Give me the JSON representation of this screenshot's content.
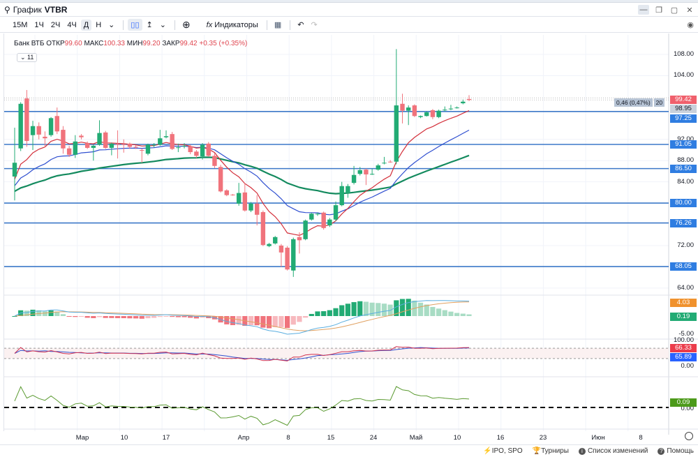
{
  "window": {
    "title_prefix": "График",
    "ticker": "VTBR"
  },
  "toolbar": {
    "timeframes": [
      "15М",
      "1Ч",
      "2Ч",
      "4Ч",
      "Д",
      "Н"
    ],
    "active_timeframe": "Д",
    "indicators_label": "Индикаторы"
  },
  "legend": {
    "name": "Банк ВТБ",
    "open_label": "ОТКР",
    "open": "99.60",
    "high_label": "МАКС",
    "high": "100.33",
    "low_label": "МИН",
    "low": "99.20",
    "close_label": "ЗАКР",
    "close": "99.42",
    "change": "+0.35 (+0.35%)",
    "collapsed_count": "11"
  },
  "price_axis": {
    "ticks": [
      "108.00",
      "104.00",
      "92.00",
      "88.00",
      "84.00",
      "72.00",
      "64.00"
    ],
    "tick_values": [
      108,
      104,
      92,
      88,
      84,
      72,
      64
    ]
  },
  "levels": [
    {
      "value": 97.25,
      "label": "97.25"
    },
    {
      "value": 91.05,
      "label": "91.05"
    },
    {
      "value": 86.5,
      "label": "86.50"
    },
    {
      "value": 80.0,
      "label": "80.00"
    },
    {
      "value": 76.26,
      "label": "76.26"
    },
    {
      "value": 68.05,
      "label": "68.05"
    }
  ],
  "price_labels": {
    "last": "99.42",
    "ma": "98.95",
    "diff": "0,46 (0,47%)",
    "diff_bars": "20"
  },
  "macd": {
    "ticks": [
      "-5.00"
    ],
    "signal_label": "4.03",
    "hist_label": "0.19"
  },
  "rsi": {
    "ticks": [
      "100.00",
      "0.00"
    ],
    "rsi_label": "66.33",
    "ma_label": "65.89"
  },
  "osc": {
    "ticks": [
      "0.00"
    ],
    "label": "0.09"
  },
  "time_axis": [
    "Мар",
    "10",
    "17",
    "Апр",
    "8",
    "15",
    "24",
    "Май",
    "10",
    "16",
    "23",
    "Июн",
    "8"
  ],
  "bottom": {
    "ipo": "IPO, SPO",
    "tournaments": "Турниры",
    "changes": "Список изменений",
    "help": "Помощь"
  },
  "colors": {
    "up": "#22ab74",
    "down": "#f0737c",
    "level": "#3c78c8",
    "ema_fast": "#d32f3a",
    "ema_mid": "#2f4fd0",
    "ema_slow": "#138a5e"
  },
  "chart_data": {
    "type": "candlestick",
    "ylim": [
      62,
      111
    ],
    "ema_seeds": [
      83.7,
      82.8,
      82.0
    ],
    "candles": [
      [
        85,
        94.2,
        80.5,
        87.6
      ],
      [
        90.3,
        99,
        89.8,
        98.7
      ],
      [
        99.7,
        101.3,
        90.6,
        91.7
      ],
      [
        92.8,
        95.5,
        90,
        94.5
      ],
      [
        94.5,
        95.2,
        92,
        92.9
      ],
      [
        92.5,
        93.5,
        90.5,
        92.2
      ],
      [
        92.8,
        96.2,
        92.5,
        96
      ],
      [
        96.4,
        98,
        93,
        93.5
      ],
      [
        93.8,
        94.5,
        89.3,
        90.3
      ],
      [
        90.3,
        90.8,
        88.7,
        89.1
      ],
      [
        89.1,
        92.8,
        88.5,
        91.6
      ],
      [
        92.7,
        93,
        92,
        92.4
      ],
      [
        91.3,
        91.6,
        90.2,
        90.4
      ],
      [
        90.4,
        91,
        88,
        90.8
      ],
      [
        91,
        95.6,
        90.8,
        93.2
      ],
      [
        93.3,
        93.6,
        90.2,
        90.4
      ],
      [
        90.4,
        91.4,
        89,
        91.2
      ],
      [
        91.1,
        93.7,
        88.4,
        91
      ],
      [
        91.1,
        92,
        89.5,
        91
      ],
      [
        91.2,
        91.4,
        90.2,
        90.6
      ],
      [
        90.6,
        90.9,
        90.2,
        90.5
      ],
      [
        90,
        90.3,
        87.6,
        89.9
      ],
      [
        89.3,
        91.2,
        89,
        91
      ],
      [
        91,
        91.3,
        90.5,
        91
      ],
      [
        91,
        93.8,
        90.8,
        92.2
      ],
      [
        92.4,
        93.7,
        92.2,
        92.6
      ],
      [
        93,
        93.4,
        90,
        90.2
      ],
      [
        90.4,
        91.2,
        89.6,
        90.5
      ],
      [
        90.7,
        91.3,
        90.3,
        90.8
      ],
      [
        90.7,
        91,
        89.2,
        89.6
      ],
      [
        89.7,
        90,
        88.5,
        88.9
      ],
      [
        88.8,
        91.3,
        88.2,
        91
      ],
      [
        91.2,
        91.5,
        88.7,
        88.9
      ],
      [
        88.9,
        89.4,
        86.6,
        87
      ],
      [
        86.8,
        87.2,
        82,
        82.2
      ],
      [
        82.4,
        82.6,
        81.3,
        81.5
      ],
      [
        81.6,
        81.7,
        81.4,
        81.5
      ],
      [
        79.9,
        83.8,
        79.5,
        81.9
      ],
      [
        82,
        83.8,
        78.4,
        78.6
      ],
      [
        78.6,
        80.2,
        78.3,
        79.9
      ],
      [
        79.9,
        81.5,
        75.8,
        77.8
      ],
      [
        78.3,
        78.6,
        71.9,
        72.1
      ],
      [
        71.9,
        72.5,
        71.7,
        72.3
      ],
      [
        72.4,
        73.8,
        72.2,
        73.6
      ],
      [
        72,
        72.3,
        68,
        70.7
      ],
      [
        71.6,
        71.9,
        67.3,
        67.5
      ],
      [
        67.3,
        73.5,
        66.1,
        73.2
      ],
      [
        73.6,
        74.5,
        70.5,
        73
      ],
      [
        73.2,
        76.9,
        73,
        76.7
      ],
      [
        76.9,
        78.2,
        76.7,
        78
      ],
      [
        78,
        78.2,
        77.6,
        78
      ],
      [
        78.2,
        78.4,
        75,
        75.3
      ],
      [
        75.8,
        77.2,
        75.5,
        76.9
      ],
      [
        76.9,
        80.3,
        76.6,
        79.6
      ],
      [
        79.6,
        84,
        79.4,
        83.2
      ],
      [
        81.9,
        83.6,
        81,
        83.2
      ],
      [
        83.8,
        87,
        83.5,
        85.3
      ],
      [
        85.5,
        86.8,
        85.2,
        86.2
      ],
      [
        86.3,
        86.5,
        83.4,
        85.4
      ],
      [
        85.4,
        86.5,
        85.3,
        85.5
      ],
      [
        86.3,
        87.4,
        86.1,
        87.1
      ],
      [
        87.5,
        88.7,
        87.3,
        87.6
      ],
      [
        87.8,
        88.1,
        87.6,
        87.7
      ],
      [
        87.8,
        109,
        87.3,
        98.4
      ],
      [
        98.7,
        100.6,
        95,
        97.4
      ],
      [
        97.4,
        98.4,
        94.7,
        98
      ],
      [
        98.4,
        98.6,
        96.2,
        96.4
      ],
      [
        96.2,
        96.5,
        96,
        96.4
      ],
      [
        96.4,
        97.3,
        96.3,
        97.1
      ],
      [
        97.5,
        97.7,
        95.8,
        96.2
      ],
      [
        96.2,
        97.6,
        96,
        97.4
      ],
      [
        97.5,
        98.2,
        97.3,
        97.6
      ],
      [
        97.8,
        98.5,
        97.5,
        97.8
      ],
      [
        98,
        98.2,
        97.8,
        98
      ],
      [
        98.8,
        99.5,
        98.6,
        99.1
      ],
      [
        99.6,
        100.33,
        99.2,
        99.42
      ]
    ]
  }
}
